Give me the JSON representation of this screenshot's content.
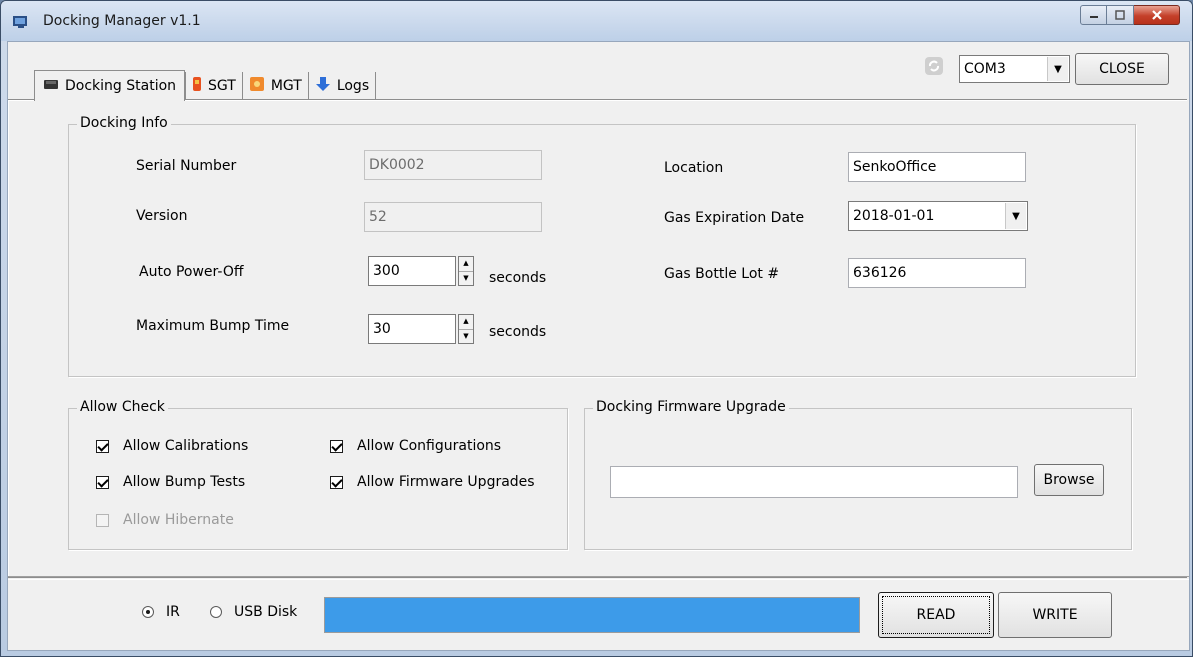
{
  "window": {
    "title": "Docking Manager v1.1"
  },
  "tabs": [
    {
      "label": "Docking Station",
      "icon": "docking-station-icon"
    },
    {
      "label": "SGT",
      "icon": "sgt-detector-icon"
    },
    {
      "label": "MGT",
      "icon": "mgt-detector-icon"
    },
    {
      "label": "Logs",
      "icon": "download-arrow-icon"
    }
  ],
  "toolbar": {
    "port_value": "COM3",
    "close_label": "CLOSE",
    "refresh_icon": "refresh-icon"
  },
  "docking_info": {
    "title": "Docking Info",
    "serial_label": "Serial Number",
    "serial_value": "DK0002",
    "version_label": "Version",
    "version_value": "52",
    "autopower_label": "Auto Power-Off",
    "autopower_value": "300",
    "autopower_unit": "seconds",
    "bump_label": "Maximum Bump Time",
    "bump_value": "30",
    "bump_unit": "seconds",
    "location_label": "Location",
    "location_value": "SenkoOffice",
    "gas_exp_label": "Gas Expiration Date",
    "gas_exp_value": "2018-01-01",
    "lot_label": "Gas Bottle Lot #",
    "lot_value": "636126"
  },
  "allow_check": {
    "title": "Allow Check",
    "items": [
      {
        "label": "Allow Calibrations",
        "checked": true,
        "enabled": true
      },
      {
        "label": "Allow Configurations",
        "checked": true,
        "enabled": true
      },
      {
        "label": "Allow Bump Tests",
        "checked": true,
        "enabled": true
      },
      {
        "label": "Allow Firmware Upgrades",
        "checked": true,
        "enabled": true
      },
      {
        "label": "Allow Hibernate",
        "checked": false,
        "enabled": false
      }
    ]
  },
  "firmware": {
    "title": "Docking Firmware Upgrade",
    "path_value": "",
    "browse_label": "Browse"
  },
  "bottom": {
    "ir_label": "IR",
    "ir_selected": true,
    "usb_label": "USB Disk",
    "usb_selected": false,
    "progress": 1.0,
    "read_label": "READ",
    "write_label": "WRITE"
  },
  "colors": {
    "progress_fill": "#3d9be9",
    "titlebar_close": "#c4402a"
  }
}
